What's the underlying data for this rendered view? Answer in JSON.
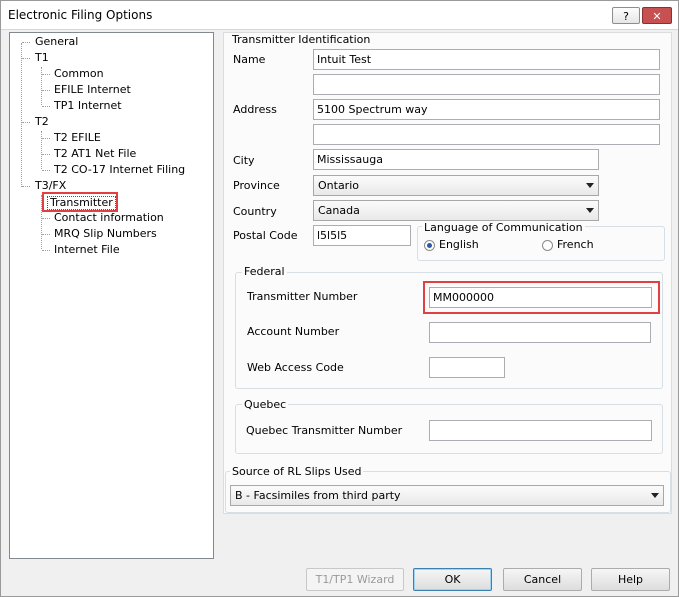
{
  "window": {
    "title": "Electronic Filing Options",
    "help_label": "?",
    "close_label": "✕"
  },
  "tree": {
    "items": [
      {
        "label": "General"
      },
      {
        "label": "T1"
      },
      {
        "label": "Common"
      },
      {
        "label": "EFILE Internet"
      },
      {
        "label": "TP1 Internet"
      },
      {
        "label": "T2"
      },
      {
        "label": "T2 EFILE"
      },
      {
        "label": "T2 AT1 Net File"
      },
      {
        "label": "T2 CO-17 Internet Filing"
      },
      {
        "label": "T3/FX"
      },
      {
        "label": "Transmitter",
        "selected": true
      },
      {
        "label": "Contact information"
      },
      {
        "label": "MRQ Slip Numbers"
      },
      {
        "label": "Internet File"
      }
    ]
  },
  "transmitter_identification": {
    "group_label": "Transmitter Identification",
    "name_label": "Name",
    "name_value": "Intuit Test",
    "name2_value": "",
    "address_label": "Address",
    "address_value": "5100 Spectrum way",
    "address2_value": "",
    "city_label": "City",
    "city_value": "Mississauga",
    "province_label": "Province",
    "province_value": "Ontario",
    "country_label": "Country",
    "country_value": "Canada",
    "postal_code_label": "Postal Code",
    "postal_code_value": "l5l5l5"
  },
  "language": {
    "group_label": "Language of Communication",
    "english_label": "English",
    "french_label": "French",
    "selected": "English"
  },
  "federal": {
    "group_label": "Federal",
    "transmitter_number_label": "Transmitter Number",
    "transmitter_number_value": "MM000000",
    "account_number_label": "Account Number",
    "account_number_value": "",
    "web_access_code_label": "Web Access Code",
    "web_access_code_value": ""
  },
  "quebec": {
    "group_label": "Quebec",
    "transmitter_number_label": "Quebec Transmitter Number",
    "transmitter_number_value": ""
  },
  "rl_slips": {
    "group_label": "Source of RL Slips Used",
    "value": "B - Facsimiles from third party"
  },
  "buttons": {
    "wizard": "T1/TP1 Wizard",
    "ok": "OK",
    "cancel": "Cancel",
    "help": "Help"
  },
  "colors": {
    "highlight": "#e04040",
    "radio_dot": "#2b59a8"
  }
}
